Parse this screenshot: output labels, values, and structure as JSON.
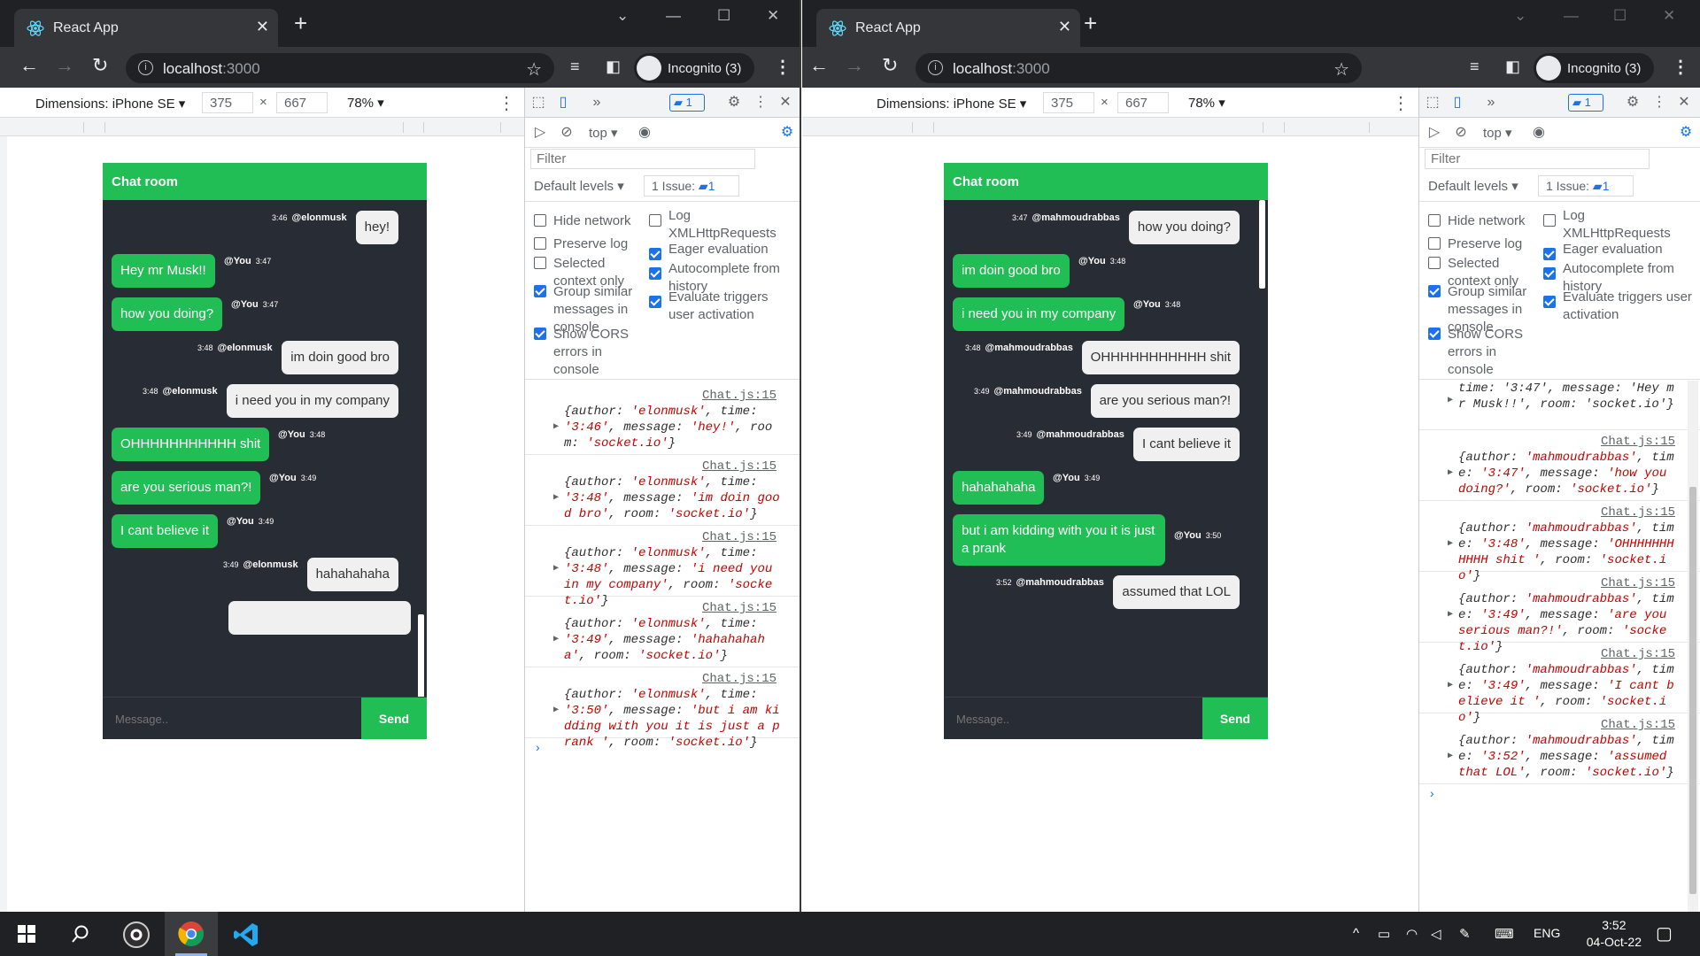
{
  "browser": {
    "tab_title": "React App",
    "url_host": "localhost",
    "url_port": ":3000",
    "profile_label": "Incognito (3)"
  },
  "device_toolbar": {
    "dimensions_label": "Dimensions: iPhone SE ▾",
    "width": "375",
    "height": "667",
    "times": "×",
    "zoom": "78% ▾"
  },
  "chat_app": {
    "header": "Chat room",
    "input_placeholder": "Message..",
    "send_label": "Send"
  },
  "devtools": {
    "messages_count": "1",
    "context": "top ▾",
    "filter_placeholder": "Filter",
    "levels": "Default levels ▾",
    "issues": "1 Issue:",
    "issues_count": "1",
    "settings_left": [
      {
        "label": "Hide network",
        "checked": false
      },
      {
        "label": "Preserve log",
        "checked": false
      },
      {
        "label": "Selected context only",
        "checked": false
      },
      {
        "label": "Group similar messages in console",
        "checked": true
      },
      {
        "label": "Show CORS errors in console",
        "checked": true
      }
    ],
    "settings_right": [
      {
        "label": "Log XMLHttpRequests",
        "checked": false
      },
      {
        "label": "Eager evaluation",
        "checked": true
      },
      {
        "label": "Autocomplete from history",
        "checked": true
      },
      {
        "label": "Evaluate triggers user activation",
        "checked": true
      }
    ],
    "prompt": "›"
  },
  "left_window": {
    "messages": [
      {
        "side": "other",
        "author": "@elonmusk",
        "time": "3:46",
        "text": "hey!"
      },
      {
        "side": "me",
        "author": "@You",
        "time": "3:47",
        "text": "Hey mr Musk!!"
      },
      {
        "side": "me",
        "author": "@You",
        "time": "3:47",
        "text": "how you doing?"
      },
      {
        "side": "other",
        "author": "@elonmusk",
        "time": "3:48",
        "text": "im doin good bro"
      },
      {
        "side": "other",
        "author": "@elonmusk",
        "time": "3:48",
        "text": "i need you in my company"
      },
      {
        "side": "me",
        "author": "@You",
        "time": "3:48",
        "text": "OHHHHHHHHHHH shit"
      },
      {
        "side": "me",
        "author": "@You",
        "time": "3:49",
        "text": "are you serious man?!"
      },
      {
        "side": "me",
        "author": "@You",
        "time": "3:49",
        "text": "I cant believe it"
      },
      {
        "side": "other",
        "author": "@elonmusk",
        "time": "3:49",
        "text": "hahahahaha"
      }
    ],
    "console_logs": [
      {
        "src": "Chat.js:15",
        "author": "elonmusk",
        "time": "3:46",
        "message": "hey!",
        "room": "socket.io"
      },
      {
        "src": "Chat.js:15",
        "author": "elonmusk",
        "time": "3:48",
        "message": "im doin good bro",
        "room": "socket.io"
      },
      {
        "src": "Chat.js:15",
        "author": "elonmusk",
        "time": "3:48",
        "message": "i need you in my company",
        "room": "socket.io"
      },
      {
        "src": "Chat.js:15",
        "author": "elonmusk",
        "time": "3:49",
        "message": "hahahahaha",
        "room": "socket.io"
      },
      {
        "src": "Chat.js:15",
        "author": "elonmusk",
        "time": "3:50",
        "message": "but i am kidding with you it is just a prank ",
        "room": "socket.io"
      }
    ]
  },
  "right_window": {
    "messages": [
      {
        "side": "other",
        "author": "@mahmoudrabbas",
        "time": "3:47",
        "text": "how you doing?"
      },
      {
        "side": "me",
        "author": "@You",
        "time": "3:48",
        "text": "im doin good bro"
      },
      {
        "side": "me",
        "author": "@You",
        "time": "3:48",
        "text": "i need you in my company"
      },
      {
        "side": "other",
        "author": "@mahmoudrabbas",
        "time": "3:48",
        "text": "OHHHHHHHHHHH shit"
      },
      {
        "side": "other",
        "author": "@mahmoudrabbas",
        "time": "3:49",
        "text": "are you serious man?!"
      },
      {
        "side": "other",
        "author": "@mahmoudrabbas",
        "time": "3:49",
        "text": "I cant believe it"
      },
      {
        "side": "me",
        "author": "@You",
        "time": "3:49",
        "text": "hahahahaha"
      },
      {
        "side": "me",
        "author": "@You",
        "time": "3:50",
        "text": "but i am kidding with you it is just a prank"
      },
      {
        "side": "other",
        "author": "@mahmoudrabbas",
        "time": "3:52",
        "text": "assumed that LOL"
      }
    ],
    "console_partial": "time: '3:47', message: 'Hey mr Musk!!', room: 'socket.io'}",
    "console_logs": [
      {
        "src": "Chat.js:15",
        "author": "mahmoudrabbas",
        "time": "3:47",
        "message": "how you doing?",
        "room": "socket.io"
      },
      {
        "src": "Chat.js:15",
        "author": "mahmoudrabbas",
        "time": "3:48",
        "message": "OHHHHHHHHHHH shit ",
        "room": "socket.io"
      },
      {
        "src": "Chat.js:15",
        "author": "mahmoudrabbas",
        "time": "3:49",
        "message": "are you serious man?!",
        "room": "socket.io"
      },
      {
        "src": "Chat.js:15",
        "author": "mahmoudrabbas",
        "time": "3:49",
        "message": "I cant believe it ",
        "room": "socket.io"
      },
      {
        "src": "Chat.js:15",
        "author": "mahmoudrabbas",
        "time": "3:52",
        "message": "assumed that LOL",
        "room": "socket.io"
      }
    ]
  },
  "taskbar": {
    "language": "ENG",
    "time": "3:52",
    "date": "04-Oct-22"
  }
}
